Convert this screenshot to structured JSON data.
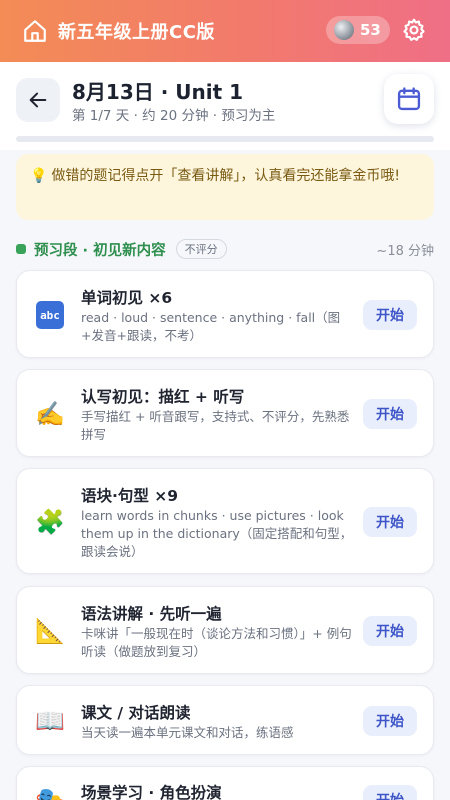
{
  "app": {
    "title": "新五年级上册CC版",
    "coins": "53"
  },
  "header": {
    "day_title": "8月13日 · Unit 1",
    "day_sub": "第 1/7 天 · 约 20 分钟 · 预习为主",
    "progress": 0.0
  },
  "tip": {
    "text": "做错的题记得点开「查看讲解」，认真看完还能拿金币哦!"
  },
  "section": {
    "title": "预习段 · 初见新内容",
    "badge": "不评分",
    "time": "~18 分钟"
  },
  "tasks": [
    {
      "icon": "abc-icon",
      "title": "单词初见 ×6",
      "desc": "read · loud · sentence · anything · fall（图+发音+跟读，不考）",
      "button": "开始"
    },
    {
      "icon": "writing-hand-icon",
      "title": "认写初见：描红 + 听写",
      "desc": "手写描红 + 听音跟写，支持式、不评分，先熟悉拼写",
      "button": "开始"
    },
    {
      "icon": "puzzle-icon",
      "title": "语块·句型 ×9",
      "desc": "learn words in chunks · use pictures · look them up in the dictionary（固定搭配和句型，跟读会说）",
      "button": "开始"
    },
    {
      "icon": "ruler-triangle-icon",
      "title": "语法讲解 · 先听一遍",
      "desc": "卡咪讲「一般现在时（谈论方法和习惯）」+ 例句听读（做题放到复习）",
      "button": "开始"
    },
    {
      "icon": "open-book-icon",
      "title": "课文 / 对话朗读",
      "desc": "当天读一遍本单元课文和对话，练语感",
      "button": "开始"
    },
    {
      "icon": "mask-icon",
      "title": "场景学习 · 角色扮演",
      "desc": "",
      "button": "开始"
    }
  ],
  "colors": {
    "header_gradient_start": "#f38c55",
    "header_gradient_end": "#ef6f86",
    "accent_blue": "#3e55c8",
    "section_green": "#2e8f4e",
    "tip_bg": "#fdf6dd"
  }
}
